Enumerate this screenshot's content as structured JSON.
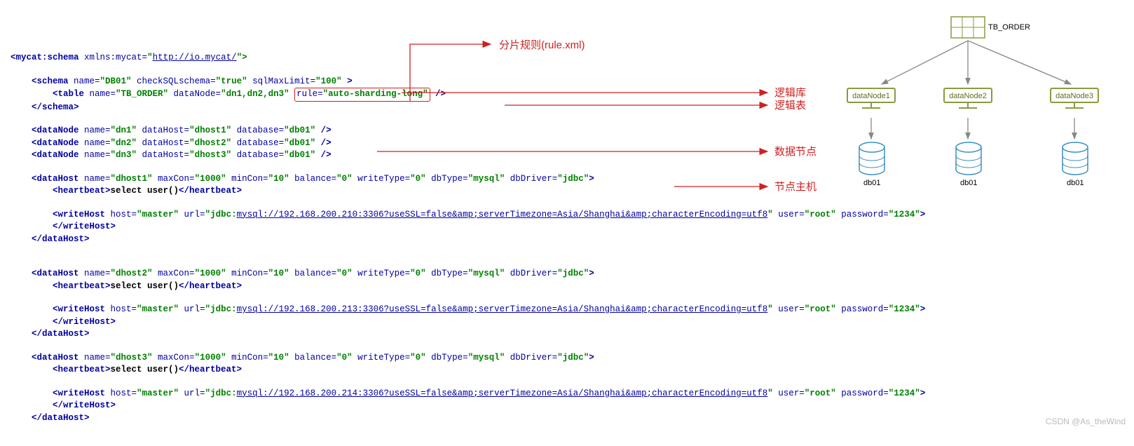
{
  "annotations": {
    "rule": "分片规则(rule.xml)",
    "logic_db": "逻辑库",
    "logic_table": "逻辑表",
    "data_node": "数据节点",
    "node_host": "节点主机"
  },
  "root": {
    "tag_open": "<mycat:schema",
    "xmlns_attr": " xmlns:mycat=",
    "xmlns_val": "\"",
    "xmlns_link": "http://io.mycat/",
    "xmlns_close": "\">"
  },
  "schema": {
    "open": "<schema",
    "a1": " name=",
    "v1": "\"DB01\"",
    "a2": " checkSQLschema=",
    "v2": "\"true\"",
    "a3": " sqlMaxLimit=",
    "v3": "\"100\"",
    "end": " >",
    "close": "</schema>"
  },
  "table": {
    "open": "<table",
    "a1": " name=",
    "v1": "\"TB_ORDER\"",
    "a2": " dataNode=",
    "v2": "\"dn1,dn2,dn3\"",
    "sp": " ",
    "ra": "rule=",
    "rv": "\"auto-sharding-long\"",
    "end": " />"
  },
  "dn1": {
    "o": "<dataNode",
    "a1": " name=",
    "v1": "\"dn1\"",
    "a2": " dataHost=",
    "v2": "\"dhost1\"",
    "a3": " database=",
    "v3": "\"db01\"",
    "e": " />"
  },
  "dn2": {
    "o": "<dataNode",
    "a1": " name=",
    "v1": "\"dn2\"",
    "a2": " dataHost=",
    "v2": "\"dhost2\"",
    "a3": " database=",
    "v3": "\"db01\"",
    "e": " />"
  },
  "dn3": {
    "o": "<dataNode",
    "a1": " name=",
    "v1": "\"dn3\"",
    "a2": " dataHost=",
    "v2": "\"dhost3\"",
    "a3": " database=",
    "v3": "\"db01\"",
    "e": " />"
  },
  "dh1": {
    "o": "<dataHost",
    "a1": " name=",
    "v1": "\"dhost1\"",
    "a2": " maxCon=",
    "v2": "\"1000\"",
    "a3": " minCon=",
    "v3": "\"10\"",
    "a4": " balance=",
    "v4": "\"0\"",
    "a5": " writeType=",
    "v5": "\"0\"",
    "a6": " dbType=",
    "v6": "\"mysql\"",
    "a7": " dbDriver=",
    "v7": "\"jdbc\"",
    "e": ">",
    "hbO": "<heartbeat>",
    "hbV": "select user()",
    "hbC": "</heartbeat>",
    "whO": "<writeHost",
    "wha1": " host=",
    "whv1": "\"master\"",
    "wha2": " url=",
    "whvq": "\"jdbc:",
    "whurl": "mysql://192.168.200.210:3306?useSSL=false&amp;serverTimezone=Asia/Shanghai&amp;characterEncoding=utf8",
    "whvq2": "\"",
    "wha3": " user=",
    "whv3": "\"root\"",
    "wha4": " password=",
    "whv4": "\"1234\"",
    "whe": ">",
    "whC": "</writeHost>",
    "c": "</dataHost>"
  },
  "dh2": {
    "o": "<dataHost",
    "a1": " name=",
    "v1": "\"dhost2\"",
    "a2": " maxCon=",
    "v2": "\"1000\"",
    "a3": " minCon=",
    "v3": "\"10\"",
    "a4": " balance=",
    "v4": "\"0\"",
    "a5": " writeType=",
    "v5": "\"0\"",
    "a6": " dbType=",
    "v6": "\"mysql\"",
    "a7": " dbDriver=",
    "v7": "\"jdbc\"",
    "e": ">",
    "hbO": "<heartbeat>",
    "hbV": "select user()",
    "hbC": "</heartbeat>",
    "whO": "<writeHost",
    "wha1": " host=",
    "whv1": "\"master\"",
    "wha2": " url=",
    "whvq": "\"jdbc:",
    "whurl": "mysql://192.168.200.213:3306?useSSL=false&amp;serverTimezone=Asia/Shanghai&amp;characterEncoding=utf8",
    "whvq2": "\"",
    "wha3": " user=",
    "whv3": "\"root\"",
    "wha4": " password=",
    "whv4": "\"1234\"",
    "whe": ">",
    "whC": "</writeHost>",
    "c": "</dataHost>"
  },
  "dh3": {
    "o": "<dataHost",
    "a1": " name=",
    "v1": "\"dhost3\"",
    "a2": " maxCon=",
    "v2": "\"1000\"",
    "a3": " minCon=",
    "v3": "\"10\"",
    "a4": " balance=",
    "v4": "\"0\"",
    "a5": " writeType=",
    "v5": "\"0\"",
    "a6": " dbType=",
    "v6": "\"mysql\"",
    "a7": " dbDriver=",
    "v7": "\"jdbc\"",
    "e": ">",
    "hbO": "<heartbeat>",
    "hbV": "select user()",
    "hbC": "</heartbeat>",
    "whO": "<writeHost",
    "wha1": " host=",
    "whv1": "\"master\"",
    "wha2": " url=",
    "whvq": "\"jdbc:",
    "whurl": "mysql://192.168.200.214:3306?useSSL=false&amp;serverTimezone=Asia/Shanghai&amp;characterEncoding=utf8",
    "whvq2": "\"",
    "wha3": " user=",
    "whv3": "\"root\"",
    "wha4": " password=",
    "whv4": "\"1234\"",
    "whe": ">",
    "whC": "</writeHost>",
    "c": "</dataHost>"
  },
  "diagram": {
    "tb": "TB_ORDER",
    "nodes": [
      "dataNode1",
      "dataNode2",
      "dataNode3"
    ],
    "dbs": [
      "db01",
      "db01",
      "db01"
    ]
  },
  "watermark": "CSDN @As_theWind"
}
